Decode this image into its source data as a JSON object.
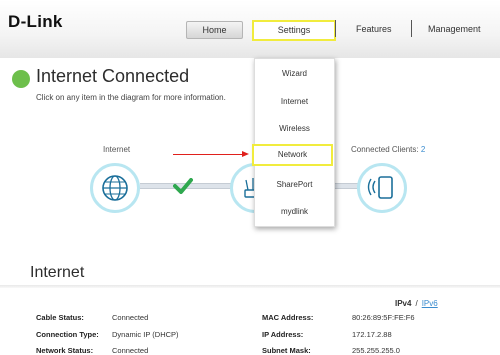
{
  "brand": {
    "logo_text": "D-Link"
  },
  "nav": {
    "home": "Home",
    "settings": "Settings",
    "features": "Features",
    "management": "Management"
  },
  "status": {
    "title": "Internet Connected",
    "subtitle": "Click on any item in the diagram for more information.",
    "indicator_color": "#6dbf4b"
  },
  "diagram": {
    "internet_label": "Internet",
    "clients_label": "Connected Clients:",
    "clients_count": "2",
    "check_color": "#2fa84f"
  },
  "settings_menu": {
    "items": [
      {
        "label": "Wizard"
      },
      {
        "label": "Internet"
      },
      {
        "label": "Wireless"
      },
      {
        "label": "Network"
      },
      {
        "label": "SharePort"
      },
      {
        "label": "mydlink"
      }
    ],
    "highlighted": "Network"
  },
  "internet_info": {
    "heading": "Internet",
    "ipv4_label": "IPv4",
    "ipv_separator": "/",
    "ipv6_label": "IPv6",
    "rows_left": [
      {
        "key": "Cable Status:",
        "value": "Connected"
      },
      {
        "key": "Connection Type:",
        "value": "Dynamic IP (DHCP)"
      },
      {
        "key": "Network Status:",
        "value": "Connected"
      }
    ],
    "rows_right": [
      {
        "key": "MAC Address:",
        "value": "80:26:89:5F:FE:F6"
      },
      {
        "key": "IP Address:",
        "value": "172.17.2.88"
      },
      {
        "key": "Subnet Mask:",
        "value": "255.255.255.0"
      }
    ]
  },
  "colors": {
    "highlight": "#f1ec3d",
    "link": "#3a8ccf",
    "annotation_arrow": "#e0201c",
    "node_ring": "#b8e6f1"
  }
}
